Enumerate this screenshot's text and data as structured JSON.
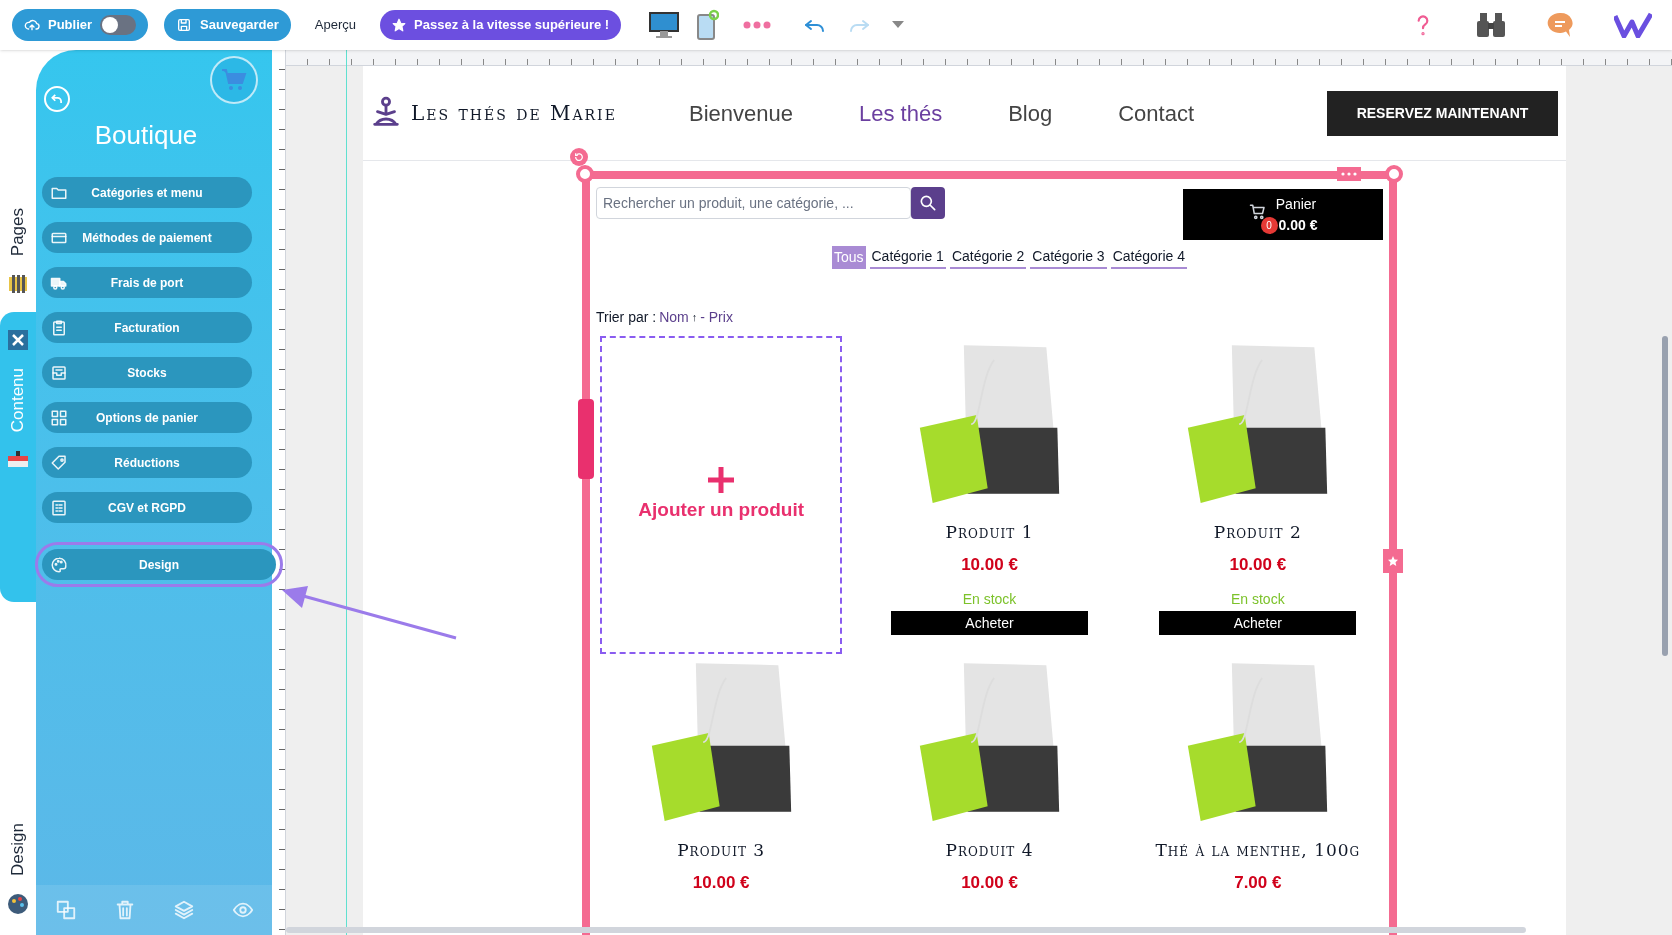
{
  "toolbar": {
    "publish": {
      "label": "Publier",
      "on": false
    },
    "save": "Sauvegarder",
    "preview": "Aperçu",
    "upgrade": "Passez à la vitesse supérieure !"
  },
  "side_tabs": [
    {
      "label": "Pages",
      "selected": false
    },
    {
      "label": "Contenu",
      "selected": true
    },
    {
      "label": "Design",
      "selected": false
    }
  ],
  "panel": {
    "title": "Boutique",
    "items": [
      {
        "label": "Catégories et menu",
        "kind": "folder",
        "selected": false
      },
      {
        "label": "Méthodes de paiement",
        "kind": "card",
        "selected": false
      },
      {
        "label": "Frais de port",
        "kind": "truck",
        "selected": false
      },
      {
        "label": "Facturation",
        "kind": "clipboard",
        "selected": false
      },
      {
        "label": "Stocks",
        "kind": "box",
        "selected": false
      },
      {
        "label": "Options de panier",
        "kind": "grid",
        "selected": false
      },
      {
        "label": "Réductions",
        "kind": "tag",
        "selected": false
      },
      {
        "label": "CGV et RGPD",
        "kind": "list",
        "selected": false
      },
      {
        "label": "Design",
        "kind": "palette",
        "selected": true
      }
    ]
  },
  "site": {
    "logo": "Les thés de Marie",
    "nav": [
      {
        "label": "Bienvenue",
        "selected": false
      },
      {
        "label": "Les thés",
        "selected": true
      },
      {
        "label": "Blog",
        "selected": false
      },
      {
        "label": "Contact",
        "selected": false
      }
    ],
    "cta": "RESERVEZ MAINTENANT"
  },
  "shop": {
    "search": {
      "placeholder": "Rechercher un produit, une catégorie, ..."
    },
    "cart": {
      "label": "Panier",
      "count": "0",
      "total": "0.00 €"
    },
    "categories": [
      {
        "label": "Tous",
        "selected": true
      },
      {
        "label": "Catégorie 1",
        "selected": false
      },
      {
        "label": "Catégorie 2",
        "selected": false
      },
      {
        "label": "Catégorie 3",
        "selected": false
      },
      {
        "label": "Catégorie 4",
        "selected": false
      }
    ],
    "sort": {
      "label": "Trier par :",
      "options": [
        "Nom",
        "↑",
        "- Prix"
      ]
    },
    "add_product": "Ajouter un produit",
    "products": [
      {
        "name": "Produit 1",
        "price": "10.00 €",
        "stock": "En stock",
        "button": "Acheter"
      },
      {
        "name": "Produit 2",
        "price": "10.00 €",
        "stock": "En stock",
        "button": "Acheter"
      },
      {
        "name": "Produit 3",
        "price": "10.00 €"
      },
      {
        "name": "Produit 4",
        "price": "10.00 €"
      },
      {
        "name": "Thé à la menthe, 100g",
        "price": "7.00 €"
      }
    ]
  }
}
